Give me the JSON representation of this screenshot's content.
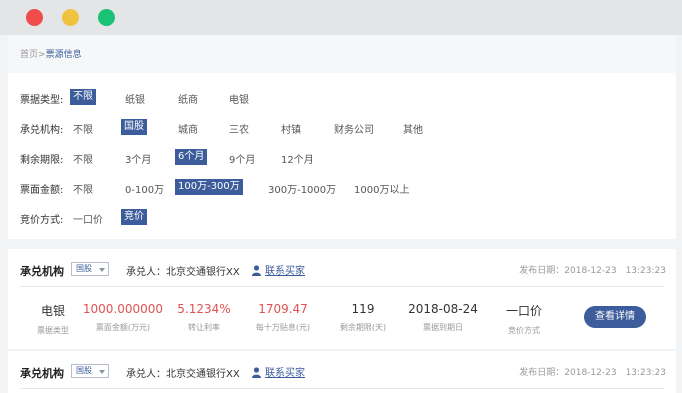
{
  "window": {
    "dots": [
      "#ef4c4c",
      "#efc23f",
      "#19c275"
    ]
  },
  "breadcrumb": {
    "home": "首页",
    "separator": ">",
    "current": "票源信息"
  },
  "filters": [
    {
      "label": "票据类型:",
      "options": [
        "不限",
        "纸银",
        "纸商",
        "电银"
      ],
      "selected": "不限"
    },
    {
      "label": "承兑机构:",
      "options": [
        "不限",
        "国股",
        "城商",
        "三农",
        "村镇",
        "财务公司",
        "其他"
      ],
      "selected": "国股"
    },
    {
      "label": "剩余期限:",
      "options": [
        "不限",
        "3个月",
        "6个月",
        "9个月",
        "12个月"
      ],
      "selected": "6个月"
    },
    {
      "label": "票面金额:",
      "options": [
        "不限",
        "0-100万",
        "100万-300万",
        "300万-1000万",
        "1000万以上"
      ],
      "selected": "100万-300万"
    },
    {
      "label": "竞价方式:",
      "options": [
        "一口价",
        "竞价"
      ],
      "selected": "竞价"
    }
  ],
  "listings": [
    {
      "institution_label": "承兑机构",
      "institution_type": "国股",
      "acceptor": "承兑人：北京交通银行XX",
      "contact": "联系买家",
      "publish_date": "发布日期：2018-12-23　13:23:23",
      "fields": [
        {
          "value": "电银",
          "label": "票据类型"
        },
        {
          "value": "1000.000000",
          "label": "票面金额(万元)",
          "highlight": true
        },
        {
          "value": "5.1234%",
          "label": "转让利率",
          "highlight": true
        },
        {
          "value": "1709.47",
          "label": "每十万贴息(元)",
          "highlight": true
        },
        {
          "value": "119",
          "label": "剩余期限(天)"
        },
        {
          "value": "2018-08-24",
          "label": "票据到期日"
        },
        {
          "value": "一口价",
          "label": "竞价方式"
        }
      ],
      "action": "查看详情"
    },
    {
      "institution_label": "承兑机构",
      "institution_type": "国股",
      "acceptor": "承兑人：北京交通银行XX",
      "contact": "联系买家",
      "publish_date": "发布日期：2018-12-23　13:23:23"
    }
  ],
  "colors": {
    "accent": "#3d5c9b",
    "highlight": "#e05252"
  },
  "icons": {
    "contact": "user-icon",
    "select": "caret-down-icon"
  }
}
